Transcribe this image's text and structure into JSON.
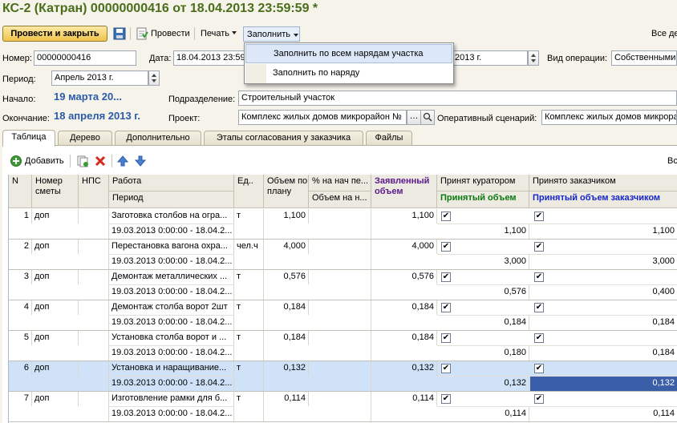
{
  "window": {
    "title": "КС-2 (Катран) 00000000416 от 18.04.2013 23:59:59 *"
  },
  "toolbar": {
    "post_close": "Провести и закрыть",
    "post": "Провести",
    "print": "Печать",
    "fill": "Заполнить",
    "all_actions": "Все де"
  },
  "fill_menu": {
    "items": [
      "Заполнить по всем нарядам участка",
      "Заполнить по наряду"
    ]
  },
  "form": {
    "number_label": "Номер:",
    "number_value": "00000000416",
    "date_label": "Дата:",
    "date_value": "18.04.2013 23:59",
    "date2_value": "2013 г.",
    "operation_label": "Вид операции:",
    "operation_value": "Собственными",
    "period_label": "Период:",
    "period_value": "Апрель 2013 г.",
    "start_label": "Начало:",
    "start_value": "19 марта 20...",
    "end_label": "Окончание:",
    "end_value": "18 апреля 2013 г.",
    "division_label": "Подразделение:",
    "division_value": "Строительный участок",
    "project_label": "Проект:",
    "project_value": "Комплекс жилых домов микрорайон №",
    "scenario_label": "Оперативный сценарий:",
    "scenario_value": "Комплекс жилых домов микрора"
  },
  "tabs": [
    "Таблица",
    "Дерево",
    "Дополнительно",
    "Этапы согласования у заказчика",
    "Файлы"
  ],
  "grid_toolbar": {
    "add": "Добавить",
    "right": "Вс"
  },
  "grid": {
    "headers": {
      "n": "N",
      "estimate": "Номер сметы",
      "nps": "НПС",
      "work": "Работа",
      "period": "Период",
      "unit": "Ед..",
      "planned": "Объем по плану",
      "pct": "% на нач пе...",
      "pct_volume": "Объем на н...",
      "declared": "Заявленный объем",
      "curator": "Принят куратором",
      "curator_volume": "Принятый объем",
      "customer": "Принято заказчиком",
      "customer_volume": "Принятый объем заказчиком"
    },
    "rows": [
      {
        "n": "1",
        "estimate": "доп",
        "work": "Заготовка столбов на огра...",
        "period": "19.03.2013 0:00:00 - 18.04.2...",
        "unit": "т",
        "planned": "1,100",
        "declared": "1,100",
        "curator": "1,100",
        "customer": "1,100"
      },
      {
        "n": "2",
        "estimate": "доп",
        "work": "Перестановка вагона охра...",
        "period": "19.03.2013 0:00:00 - 18.04.2...",
        "unit": "чел.ч",
        "planned": "4,000",
        "declared": "4,000",
        "curator": "3,000",
        "customer": "3,000"
      },
      {
        "n": "3",
        "estimate": "доп",
        "work": "Демонтаж металлических ...",
        "period": "19.03.2013 0:00:00 - 18.04.2...",
        "unit": "т",
        "planned": "0,576",
        "declared": "0,576",
        "curator": "0,576",
        "customer": "0,400"
      },
      {
        "n": "4",
        "estimate": "доп",
        "work": "Демонтаж столба ворот 2шт",
        "period": "19.03.2013 0:00:00 - 18.04.2...",
        "unit": "т",
        "planned": "0,184",
        "declared": "0,184",
        "curator": "0,184",
        "customer": "0,184"
      },
      {
        "n": "5",
        "estimate": "доп",
        "work": "Установка столба ворот и ...",
        "period": "19.03.2013 0:00:00 - 18.04.2...",
        "unit": "т",
        "planned": "0,184",
        "declared": "0,184",
        "curator": "0,180",
        "customer": "0,184"
      },
      {
        "n": "6",
        "estimate": "доп",
        "work": "Установка и наращивание...",
        "period": "19.03.2013 0:00:00 - 18.04.2...",
        "unit": "т",
        "planned": "0,132",
        "declared": "0,132",
        "curator": "0,132",
        "customer": "0,132"
      },
      {
        "n": "7",
        "estimate": "доп",
        "work": "Изготовление рамки для б...",
        "period": "19.03.2013 0:00:00 - 18.04.2...",
        "unit": "т",
        "planned": "0,114",
        "declared": "0,114",
        "curator": "0,114",
        "customer": "0,114"
      }
    ],
    "check_mark": "✔"
  },
  "colors": {
    "title": "#4a6e1a",
    "dates": "#2a5aa8",
    "selection": "#cfe2f7"
  }
}
